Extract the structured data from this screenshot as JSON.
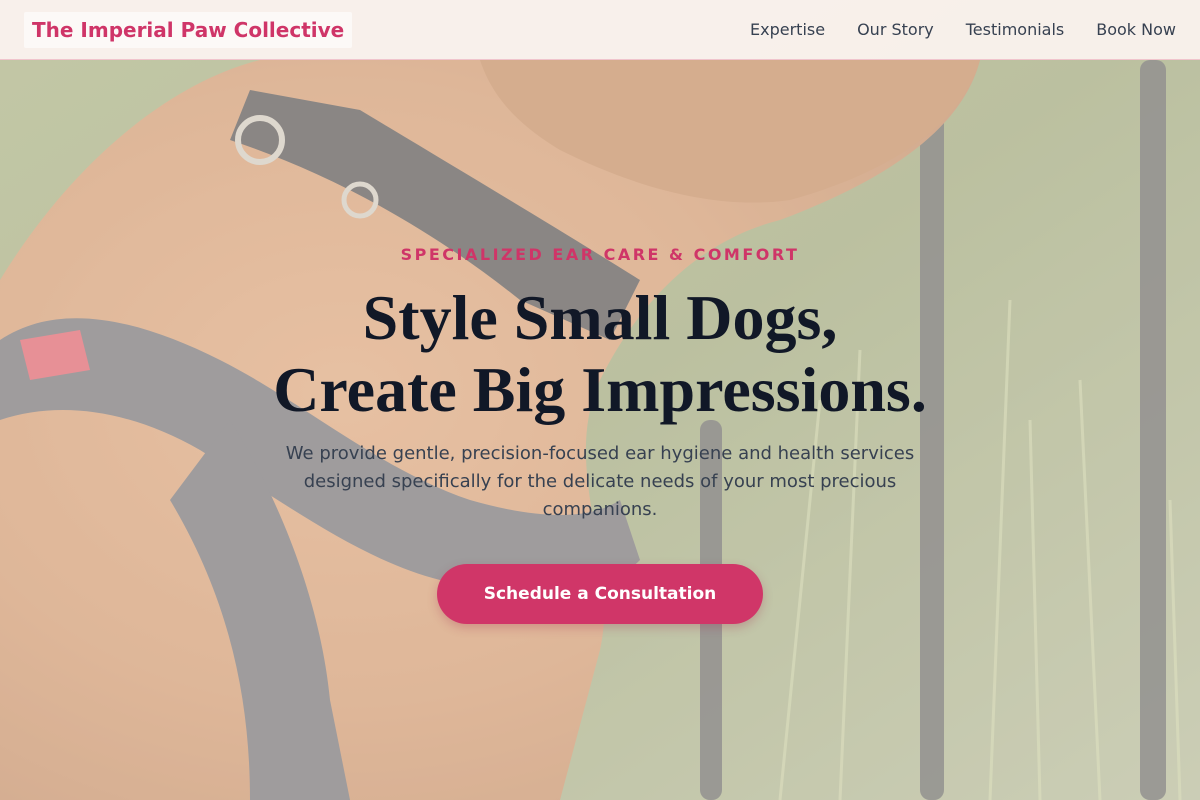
{
  "nav": {
    "brand": "The Imperial Paw Collective",
    "links": [
      "Expertise",
      "Our Story",
      "Testimonials",
      "Book Now"
    ]
  },
  "hero": {
    "eyebrow": "SPECIALIZED EAR CARE & COMFORT",
    "headline_line1": "Style Small Dogs,",
    "headline_line2": "Create Big Impressions.",
    "subtitle": "We provide gentle, precision-focused ear hygiene and health services designed specifically for the delicate needs of your most precious companions.",
    "cta_label": "Schedule a Consultation"
  },
  "colors": {
    "accent": "#cf3568",
    "heading": "#111827",
    "body_text": "#374151",
    "nav_background": "#fcf3f0"
  }
}
